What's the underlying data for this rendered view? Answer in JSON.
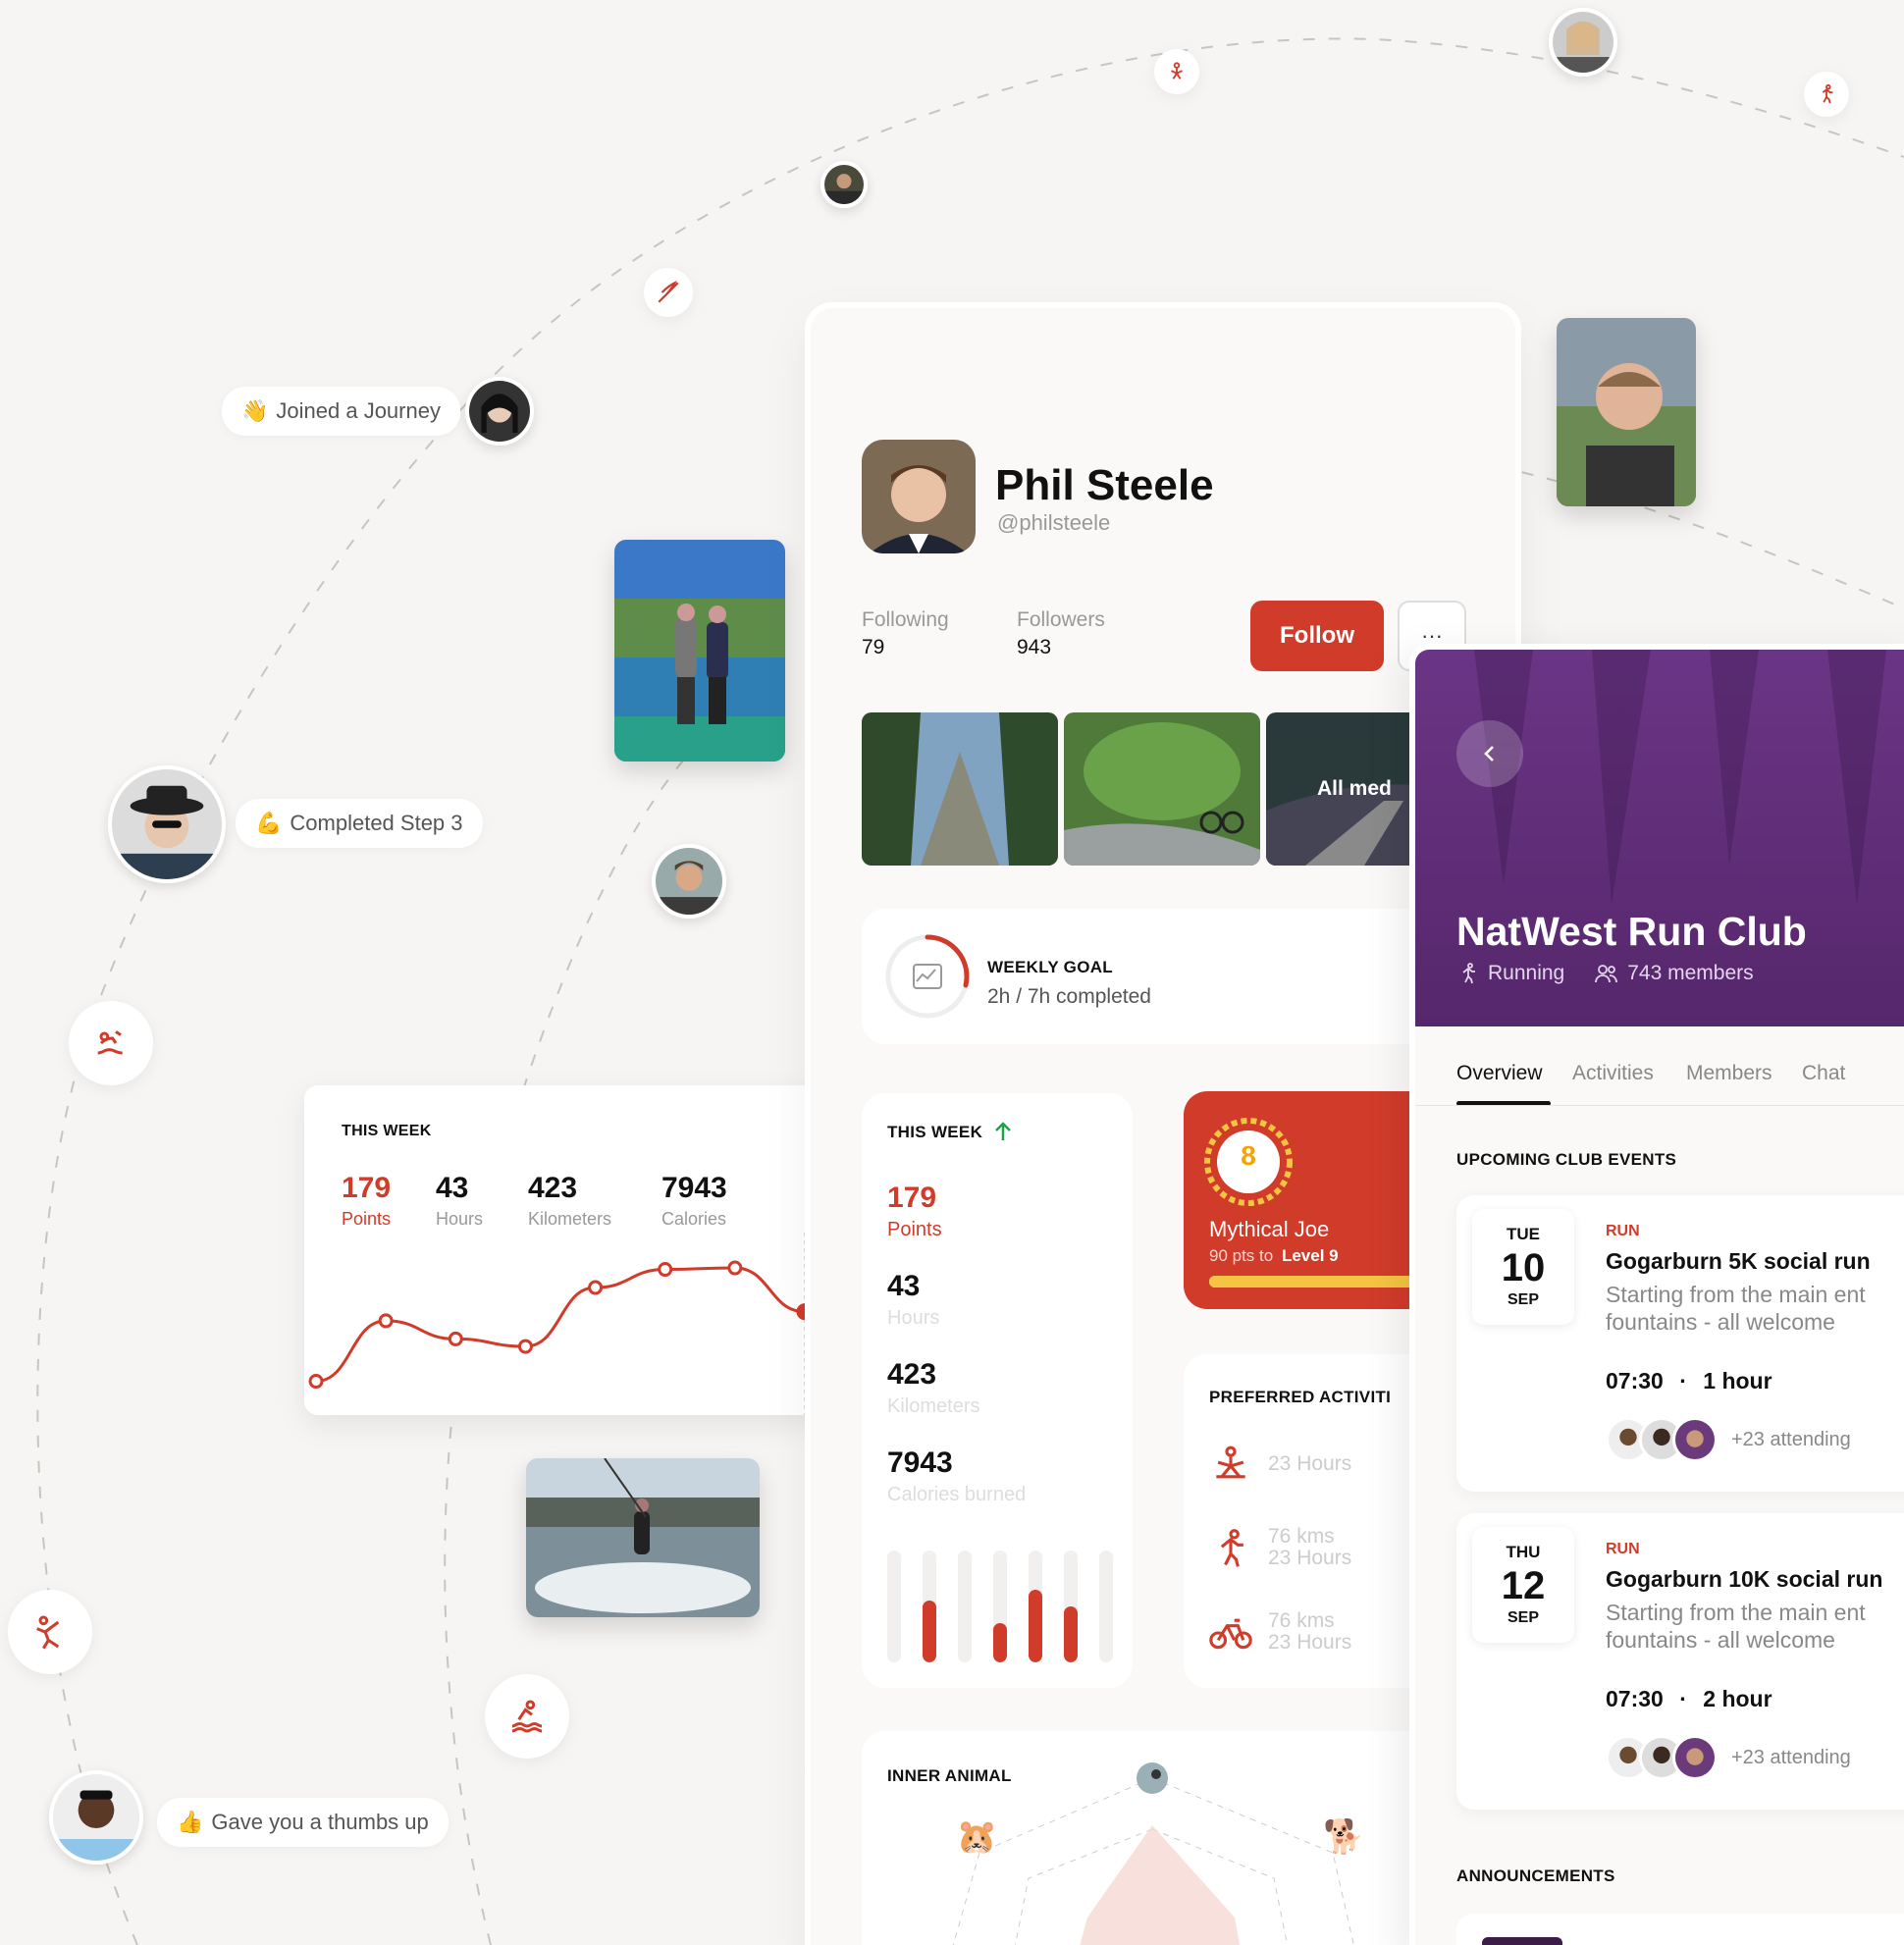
{
  "colors": {
    "accent": "#d13b2a",
    "purple": "#5b2a6e",
    "bg": "#f7f5f3"
  },
  "feed": {
    "joined": {
      "emoji": "👋",
      "text": "Joined a Journey"
    },
    "completed": {
      "emoji": "💪",
      "text": "Completed Step 3"
    },
    "thumbs": {
      "emoji": "👍",
      "text": "Gave you a thumbs up"
    }
  },
  "left_stats": {
    "heading": "THIS WEEK",
    "items": [
      {
        "value": "179",
        "label": "Points"
      },
      {
        "value": "43",
        "label": "Hours"
      },
      {
        "value": "423",
        "label": "Kilometers"
      },
      {
        "value": "7943",
        "label": "Calories"
      }
    ]
  },
  "chart_data": {
    "type": "line",
    "title": "",
    "x": [
      1,
      2,
      3,
      4,
      5,
      6,
      7,
      8
    ],
    "values": [
      12,
      52,
      40,
      35,
      74,
      86,
      87,
      58
    ],
    "ylim": [
      0,
      100
    ],
    "grid": false
  },
  "profile": {
    "name": "Phil Steele",
    "handle": "@philsteele",
    "following_label": "Following",
    "following_value": "79",
    "followers_label": "Followers",
    "followers_value": "943",
    "follow_button": "Follow",
    "more_button": "···",
    "media_overlay": "All med",
    "weekly_goal_label": "WEEKLY GOAL",
    "weekly_goal_value": "2h / 7h completed",
    "weekly_goal_progress": 0.2857,
    "this_week": {
      "heading": "THIS WEEK",
      "items": [
        {
          "value": "179",
          "label": "Points"
        },
        {
          "value": "43",
          "label": "Hours"
        },
        {
          "value": "423",
          "label": "Kilometers"
        },
        {
          "value": "7943",
          "label": "Calories burned"
        }
      ],
      "bars": [
        0,
        0.55,
        0,
        0.35,
        0.65,
        0.5,
        0
      ]
    },
    "badge": {
      "level_num": "8",
      "title": "Mythical Joe",
      "sub_prefix": "90 pts to",
      "sub_level": "Level 9",
      "progress": 0.8
    },
    "preferred": {
      "heading": "PREFERRED ACTIVITI",
      "items": [
        {
          "icon": "yoga-icon",
          "line1": "23 Hours",
          "line2": ""
        },
        {
          "icon": "run-icon",
          "line1": "76 kms",
          "line2": "23 Hours"
        },
        {
          "icon": "bike-icon",
          "line1": "76 kms",
          "line2": "23 Hours"
        }
      ]
    },
    "inner_animal": {
      "heading": "INNER ANIMAL",
      "animals": [
        "🐹",
        "🐕"
      ]
    }
  },
  "club": {
    "name": "NatWest Run Club",
    "sport": "Running",
    "members": "743 members",
    "tabs": [
      "Overview",
      "Activities",
      "Members",
      "Chat"
    ],
    "active_tab": 0,
    "events_heading": "UPCOMING CLUB EVENTS",
    "events": [
      {
        "dow": "TUE",
        "day": "10",
        "month": "SEP",
        "type": "RUN",
        "title": "Gogarburn 5K social run",
        "desc1": "Starting from the main ent",
        "desc2": "fountains - all welcome",
        "time": "07:30",
        "duration": "1 hour",
        "attending": "+23 attending"
      },
      {
        "dow": "THU",
        "day": "12",
        "month": "SEP",
        "type": "RUN",
        "title": "Gogarburn 10K social run",
        "desc1": "Starting from the main ent",
        "desc2": "fountains - all welcome",
        "time": "07:30",
        "duration": "2 hour",
        "attending": "+23 attending"
      }
    ],
    "announcements_heading": "ANNOUNCEMENTS"
  }
}
